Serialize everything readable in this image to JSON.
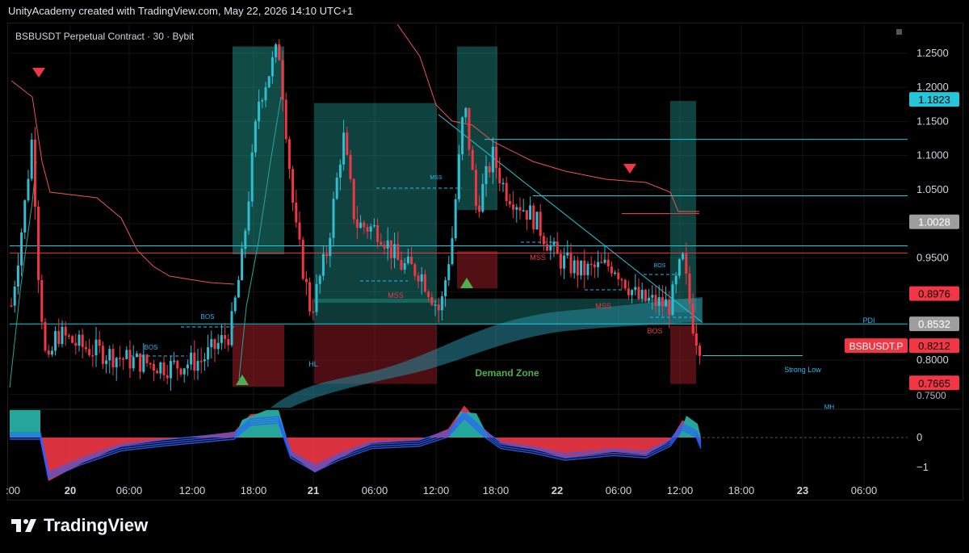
{
  "header": {
    "text": "UnityAcademy created with TradingView.com, May 22, 2026 14:10 UTC+1"
  },
  "chart_title": "BSBUSDT Perpetual Contract · 30 · Bybit",
  "footer": {
    "brand": "TradingView"
  },
  "colors": {
    "up": "#2ebdd1",
    "down": "#f23645",
    "accent_teal": "#26a69a",
    "price_line": "#ef5350",
    "bg": "#000000"
  },
  "chart_data": {
    "type": "candlestick",
    "title": "BSBUSDT Perpetual Contract · 30 · Bybit",
    "ylim": [
      0.74,
      1.29
    ],
    "yticks": [
      "1.2500",
      "1.2000",
      "1.1500",
      "1.1000",
      "1.0500",
      "1.0000",
      "0.9500",
      "0.9000",
      "0.8500",
      "0.8000",
      "0.7500"
    ],
    "xticks": [
      "20",
      "06:00",
      "12:00",
      "18:00",
      "21",
      "06:00",
      "12:00",
      "18:00",
      "22",
      "06:00",
      "12:00",
      "18:00",
      "23",
      "06:00"
    ],
    "price_labels": [
      {
        "value": 1.1823,
        "text": "1.1823",
        "color": "#26c6da"
      },
      {
        "value": 1.0028,
        "text": "1.0028",
        "color": "#9e9e9e"
      },
      {
        "value": 0.8976,
        "text": "0.8976",
        "color": "#f23645"
      },
      {
        "value": 0.8532,
        "text": "0.8532",
        "color": "#9e9e9e"
      },
      {
        "value": 0.8212,
        "text": "0.8212",
        "color": "#f23645",
        "tag": "BSBUSDT.P"
      },
      {
        "value": 0.7665,
        "text": "0.7665",
        "color": "#f23645"
      }
    ],
    "annotations": [
      "BOS",
      "BOS",
      "MSS",
      "MSS",
      "MSS",
      "MSS",
      "BOS",
      "BOS",
      "HL",
      "Demand Zone",
      "Strong Low",
      "PDI",
      "MH"
    ],
    "oscillator": {
      "yticks": [
        "0",
        "−1"
      ]
    }
  }
}
